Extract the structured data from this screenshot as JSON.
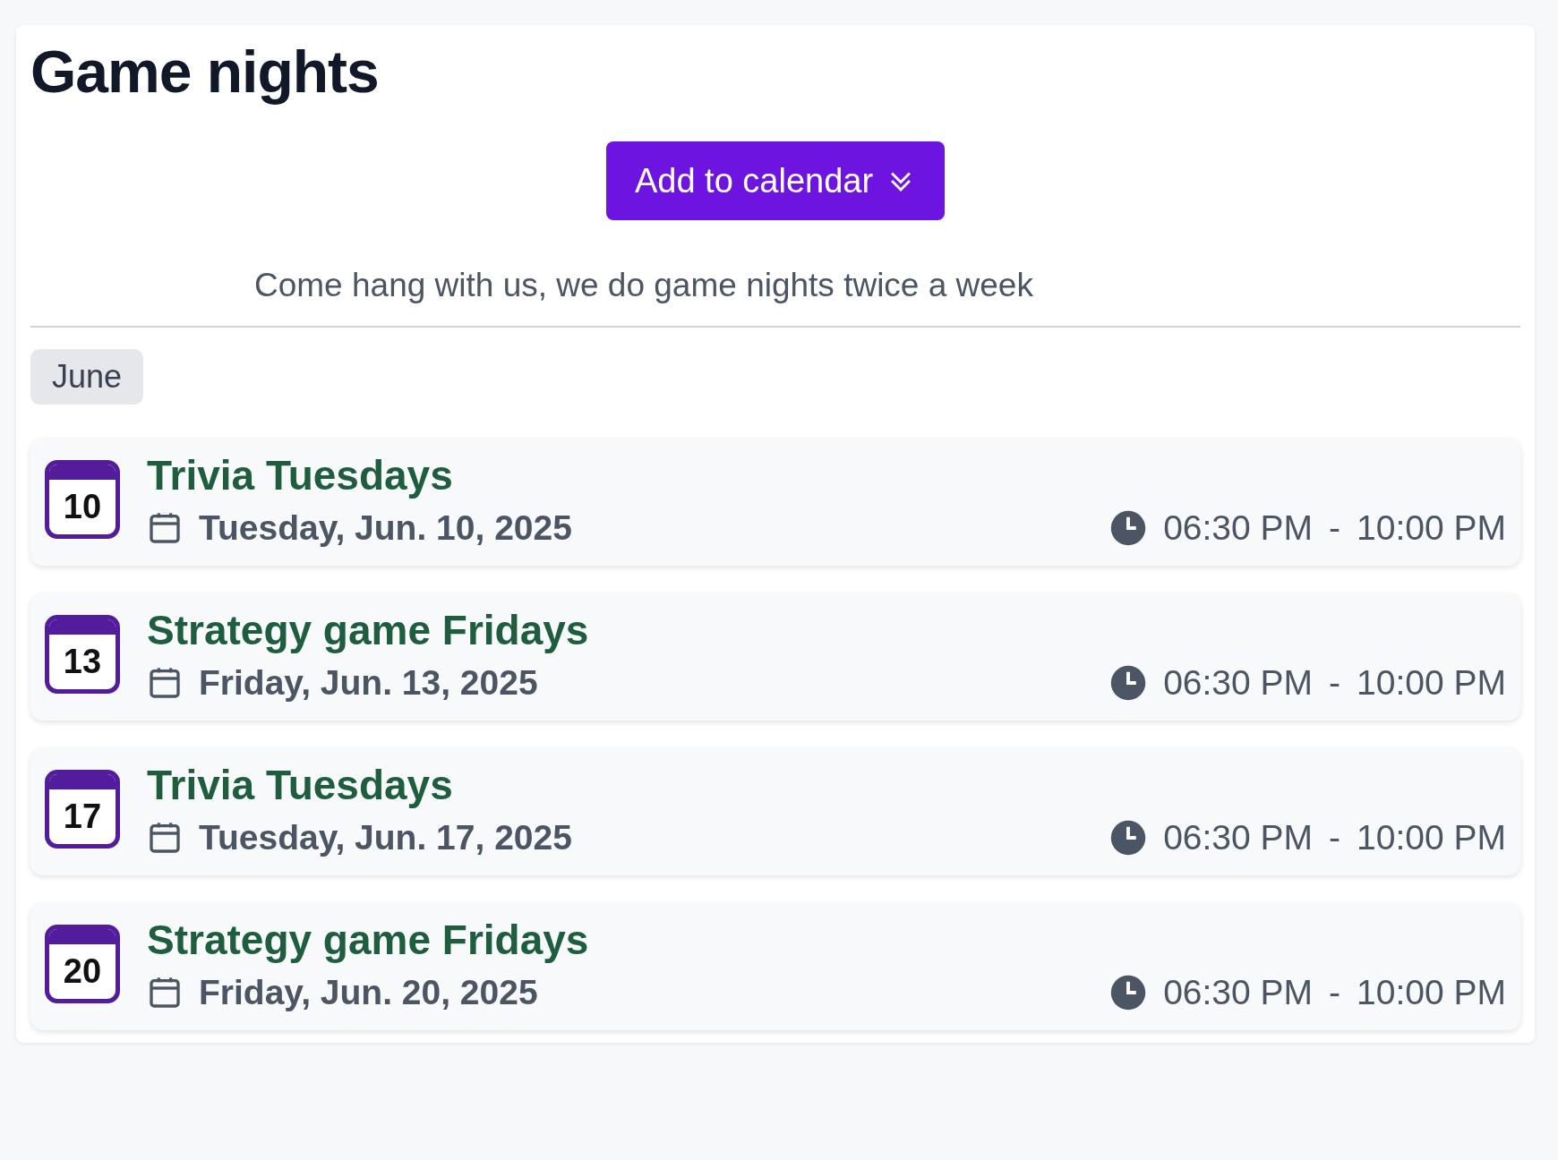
{
  "title": "Game nights",
  "button": {
    "label": "Add to calendar"
  },
  "description": "Come hang with us, we do game nights twice a week",
  "month": "June",
  "events": [
    {
      "day": "10",
      "name": "Trivia Tuesdays",
      "date": "Tuesday, Jun. 10, 2025",
      "start": "06:30 PM",
      "separator": "-",
      "end": "10:00 PM"
    },
    {
      "day": "13",
      "name": "Strategy game Fridays",
      "date": "Friday, Jun. 13, 2025",
      "start": "06:30 PM",
      "separator": "-",
      "end": "10:00 PM"
    },
    {
      "day": "17",
      "name": "Trivia Tuesdays",
      "date": "Tuesday, Jun. 17, 2025",
      "start": "06:30 PM",
      "separator": "-",
      "end": "10:00 PM"
    },
    {
      "day": "20",
      "name": "Strategy game Fridays",
      "date": "Friday, Jun. 20, 2025",
      "start": "06:30 PM",
      "separator": "-",
      "end": "10:00 PM"
    }
  ]
}
